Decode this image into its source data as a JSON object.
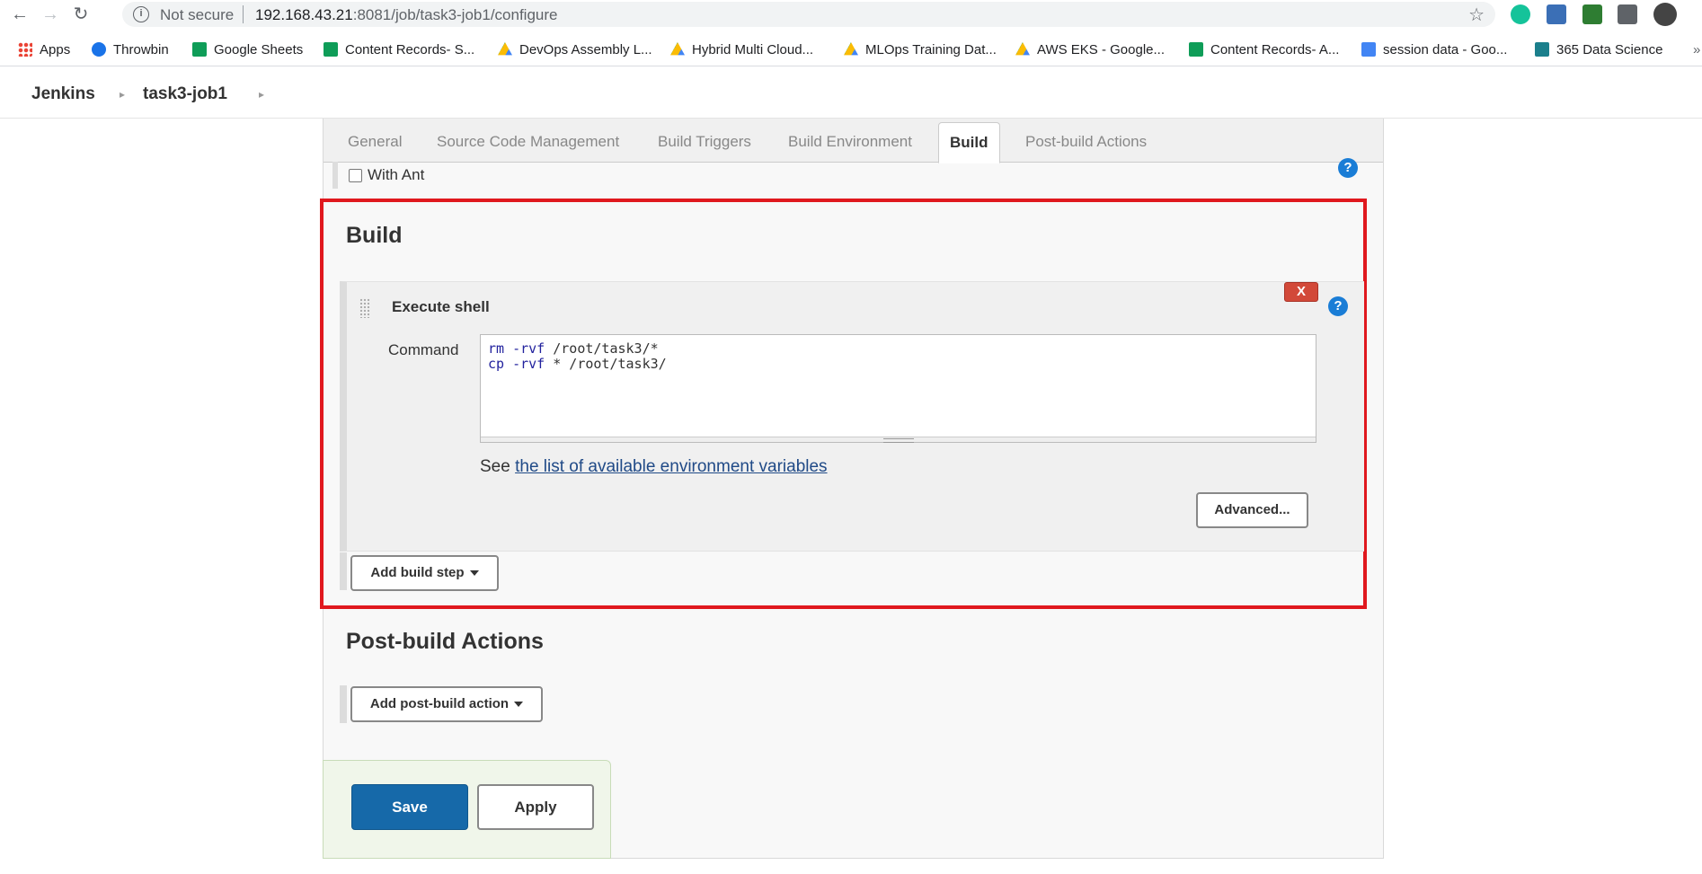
{
  "browser": {
    "security_label": "Not secure",
    "url_host": "192.168.43.21",
    "url_path": ":8081/job/task3-job1/configure",
    "bookmarks": [
      {
        "label": "Apps",
        "icon": "apps-grid-icon"
      },
      {
        "label": "Throwbin",
        "icon": "throwbin-icon"
      },
      {
        "label": "Google Sheets",
        "icon": "google-sheets-icon"
      },
      {
        "label": "Content Records- S...",
        "icon": "google-sheets-icon"
      },
      {
        "label": "DevOps Assembly L...",
        "icon": "google-drive-icon"
      },
      {
        "label": "Hybrid Multi Cloud...",
        "icon": "google-drive-icon"
      },
      {
        "label": "MLOps Training Dat...",
        "icon": "google-drive-icon"
      },
      {
        "label": "AWS EKS - Google...",
        "icon": "google-drive-icon"
      },
      {
        "label": "Content Records- A...",
        "icon": "google-sheets-icon"
      },
      {
        "label": "session data - Goo...",
        "icon": "google-docs-icon"
      },
      {
        "label": "365 Data Science",
        "icon": "data-science-icon"
      }
    ],
    "more_bookmarks": "»"
  },
  "breadcrumb": {
    "root": "Jenkins",
    "job": "task3-job1"
  },
  "tabs": [
    {
      "label": "General",
      "active": false
    },
    {
      "label": "Source Code Management",
      "active": false
    },
    {
      "label": "Build Triggers",
      "active": false
    },
    {
      "label": "Build Environment",
      "active": false
    },
    {
      "label": "Build",
      "active": true
    },
    {
      "label": "Post-build Actions",
      "active": false
    }
  ],
  "build_env": {
    "with_ant_label": "With Ant",
    "with_ant_checked": false
  },
  "build": {
    "title": "Build",
    "step": {
      "title": "Execute shell",
      "delete_label": "X",
      "command_label": "Command",
      "command_lines": [
        {
          "cmd": "rm",
          "flag": " -rvf",
          "rest": " /root/task3/*"
        },
        {
          "cmd": "cp",
          "flag": " -rvf",
          "rest": " * /root/task3/"
        }
      ],
      "see_prefix": "See ",
      "env_link": "the list of available environment variables",
      "advanced_label": "Advanced..."
    },
    "add_step_label": "Add build step"
  },
  "post_build": {
    "title": "Post-build Actions",
    "add_action_label": "Add post-build action"
  },
  "actions": {
    "save_label": "Save",
    "apply_label": "Apply"
  },
  "colors": {
    "highlight": "#e0181e",
    "save_button": "#1669a9",
    "help_icon": "#1a7dd6",
    "delete_button": "#d24939"
  }
}
